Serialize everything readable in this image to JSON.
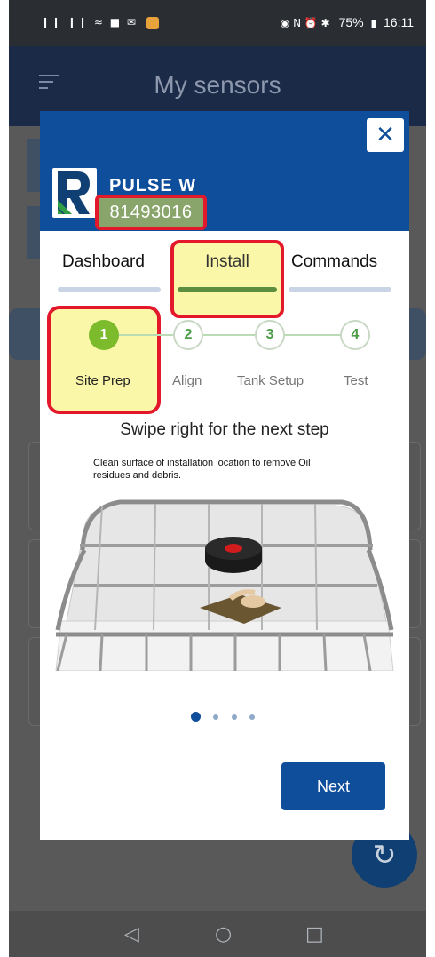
{
  "status_bar": {
    "signal": "❙❙ ❙❙ ≈ ■ ✉",
    "indicators": "◉ N ⏰ ✱",
    "battery": "75%",
    "time": "16:11"
  },
  "app_bar": {
    "title": "My sensors"
  },
  "modal": {
    "close_label": "✕",
    "device_name": "PULSE W",
    "serial": "81493016",
    "tabs": [
      {
        "label": "Dashboard",
        "active": false
      },
      {
        "label": "Install",
        "active": true
      },
      {
        "label": "Commands",
        "active": false
      }
    ],
    "steps": [
      {
        "num": "1",
        "label": "Site Prep",
        "active": true
      },
      {
        "num": "2",
        "label": "Align",
        "active": false
      },
      {
        "num": "3",
        "label": "Tank Setup",
        "active": false
      },
      {
        "num": "4",
        "label": "Test",
        "active": false
      }
    ],
    "swipe_hint": "Swipe right for the next step",
    "illustration_caption": "Clean surface of installation location to remove Oil residues and debris.",
    "pager": {
      "current": 1,
      "total": 4
    },
    "next_label": "Next"
  },
  "nav_bar": {
    "back": "◁",
    "home": "○",
    "recent": "□"
  },
  "colors": {
    "header_blue": "#0f4e9b",
    "highlight_red": "#e3182a",
    "highlight_yellow": "#fbf7a8",
    "step_green": "#7cbb2c"
  }
}
